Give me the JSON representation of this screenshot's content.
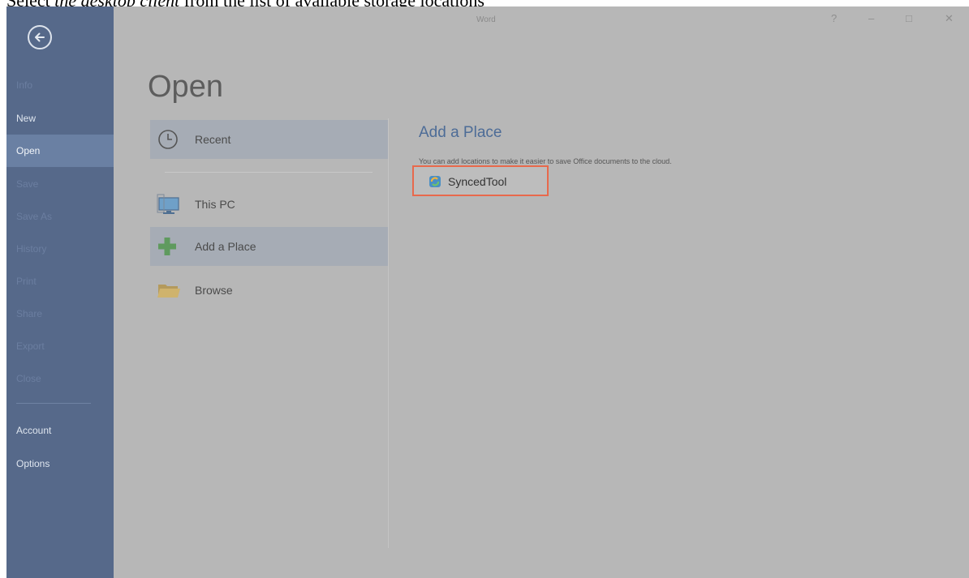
{
  "caption": {
    "prefix": "Select ",
    "emphasis": "the desktop client",
    "suffix": " from the list of available storage locations"
  },
  "window": {
    "title": "Word",
    "help": "?",
    "minimize": "–",
    "maximize": "□",
    "close": "✕"
  },
  "sidebar": {
    "items": [
      {
        "label": "Info",
        "state": "dim"
      },
      {
        "label": "New",
        "state": "normal"
      },
      {
        "label": "Open",
        "state": "active"
      },
      {
        "label": "Save",
        "state": "dim"
      },
      {
        "label": "Save As",
        "state": "dim"
      },
      {
        "label": "History",
        "state": "dim"
      },
      {
        "label": "Print",
        "state": "dim"
      },
      {
        "label": "Share",
        "state": "dim"
      },
      {
        "label": "Export",
        "state": "dim"
      },
      {
        "label": "Close",
        "state": "dim"
      },
      {
        "label": "Account",
        "state": "normal"
      },
      {
        "label": "Options",
        "state": "normal"
      }
    ]
  },
  "main": {
    "heading": "Open",
    "places": [
      {
        "label": "Recent",
        "icon": "clock-icon",
        "selected": true
      },
      {
        "label": "This PC",
        "icon": "computer-icon",
        "selected": false
      },
      {
        "label": "Add a Place",
        "icon": "plus-icon",
        "selected": true
      },
      {
        "label": "Browse",
        "icon": "folder-icon",
        "selected": false
      }
    ],
    "panel": {
      "title": "Add a Place",
      "description": "You can add locations to make it easier to save Office documents to the cloud.",
      "location": {
        "label": "SyncedTool",
        "icon": "synced-tool-icon",
        "highlight": "#e8694c"
      }
    }
  },
  "colors": {
    "sidebar": "#56698a",
    "sidebar_active": "#6a80a3",
    "background": "#b7b7b7",
    "accent": "#4d6c97"
  }
}
